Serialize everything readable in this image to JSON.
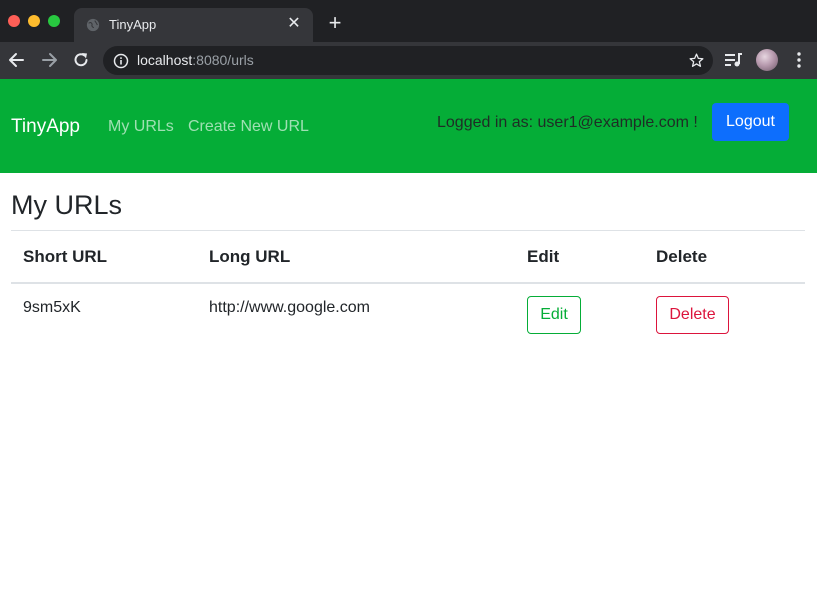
{
  "browser": {
    "tab": {
      "title": "TinyApp",
      "close_label": "✕"
    },
    "new_tab_label": "+",
    "address": {
      "host": "localhost",
      "rest": ":8080/urls"
    }
  },
  "navbar": {
    "brand": "TinyApp",
    "links": [
      "My URLs",
      "Create New URL"
    ],
    "logged_in_text": "Logged in as: user1@example.com !",
    "logout_label": "Logout"
  },
  "main": {
    "title": "My URLs",
    "table": {
      "headers": [
        "Short URL",
        "Long URL",
        "Edit",
        "Delete"
      ],
      "rows": [
        {
          "short_url": "9sm5xK",
          "long_url": "http://www.google.com",
          "edit_label": "Edit",
          "delete_label": "Delete"
        }
      ]
    }
  },
  "colors": {
    "navbar_bg": "#05ad37",
    "primary_button": "#0d6efd",
    "edit_outline": "#05ad37",
    "delete_outline": "#dc143c"
  },
  "icons": [
    "globe-icon",
    "back-arrow-icon",
    "forward-arrow-icon",
    "reload-icon",
    "info-icon",
    "star-icon",
    "media-control-icon",
    "kebab-menu-icon"
  ]
}
